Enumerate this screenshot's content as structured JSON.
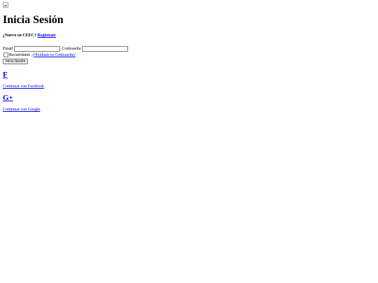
{
  "page": {
    "title": "Inicia Sesión"
  },
  "signup": {
    "prompt": "¿Nuevo en CEEC?",
    "link_label": "Registrate"
  },
  "form": {
    "email_label": "Email",
    "email_value": "",
    "password_label": "Contraseña",
    "password_value": "",
    "remember_label": "Recuérdame",
    "remember_checked": false,
    "forgot_label": "¿Olvidaste tu Contraseña?",
    "submit_label": "Inicia Sesión"
  },
  "social": {
    "facebook": {
      "icon_text": "F",
      "icon_name": "facebook-icon",
      "label": "Continuar con Facebook"
    },
    "google": {
      "icon_text": "G+",
      "icon_name": "google-plus-icon",
      "label": "Continuar con Google"
    }
  },
  "colors": {
    "link": "#0000ee",
    "text": "#000000",
    "background": "#ffffff"
  }
}
